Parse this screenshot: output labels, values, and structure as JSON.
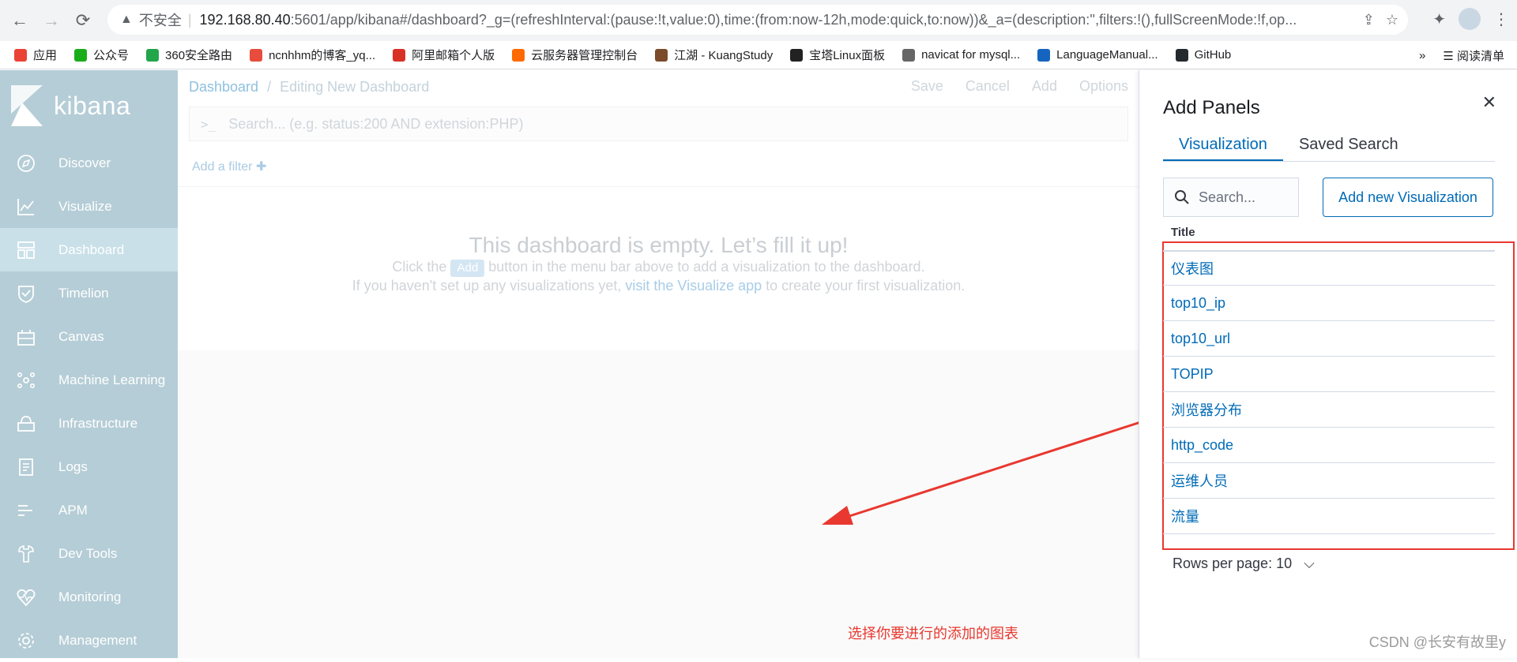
{
  "browser": {
    "security_label": "不安全",
    "url_host": "192.168.80.40",
    "url_rest": ":5601/app/kibana#/dashboard?_g=(refreshInterval:(pause:!t,value:0),time:(from:now-12h,mode:quick,to:now))&_a=(description:'',filters:!(),fullScreenMode:!f,op...",
    "bookmarks": [
      {
        "label": "应用",
        "color": "#ea4335"
      },
      {
        "label": "公众号",
        "color": "#1aad19"
      },
      {
        "label": "360安全路由",
        "color": "#23a54a"
      },
      {
        "label": "ncnhhm的博客_yq...",
        "color": "#e74c3c"
      },
      {
        "label": "阿里邮箱个人版",
        "color": "#d93025"
      },
      {
        "label": "云服务器管理控制台",
        "color": "#ff6a00"
      },
      {
        "label": "江湖 - KuangStudy",
        "color": "#7b4b2a"
      },
      {
        "label": "宝塔Linux面板",
        "color": "#222222"
      },
      {
        "label": "navicat for mysql...",
        "color": "#666666"
      },
      {
        "label": "LanguageManual...",
        "color": "#1565c0"
      },
      {
        "label": "GitHub",
        "color": "#24292e"
      }
    ],
    "more_bookmarks": "»",
    "reading_list": "阅读清单"
  },
  "kibana": {
    "logo_text": "kibana",
    "nav": [
      {
        "label": "Discover",
        "icon": "compass-icon",
        "active": false
      },
      {
        "label": "Visualize",
        "icon": "chart-icon",
        "active": false
      },
      {
        "label": "Dashboard",
        "icon": "dashboard-icon",
        "active": true
      },
      {
        "label": "Timelion",
        "icon": "shield-icon",
        "active": false
      },
      {
        "label": "Canvas",
        "icon": "canvas-icon",
        "active": false
      },
      {
        "label": "Machine Learning",
        "icon": "ml-icon",
        "active": false
      },
      {
        "label": "Infrastructure",
        "icon": "infra-icon",
        "active": false
      },
      {
        "label": "Logs",
        "icon": "logs-icon",
        "active": false
      },
      {
        "label": "APM",
        "icon": "apm-icon",
        "active": false
      },
      {
        "label": "Dev Tools",
        "icon": "wrench-icon",
        "active": false
      },
      {
        "label": "Monitoring",
        "icon": "heartbeat-icon",
        "active": false
      },
      {
        "label": "Management",
        "icon": "gear-icon",
        "active": false
      }
    ],
    "breadcrumb_root": "Dashboard",
    "breadcrumb_sep": "/",
    "breadcrumb_current": "Editing New Dashboard",
    "actions": [
      "Save",
      "Cancel",
      "Add",
      "Options"
    ],
    "query_prompt": ">_",
    "query_placeholder": "Search... (e.g. status:200 AND extension:PHP)",
    "add_filter": "Add a filter",
    "empty_title": "This dashboard is empty. Let’s fill it up!",
    "empty_line1_pre": "Click the",
    "empty_line1_chip": "Add",
    "empty_line1_post": "button in the menu bar above to add a visualization to the dashboard.",
    "empty_line2_pre": "If you haven't set up any visualizations yet,",
    "empty_line2_link": "visit the Visualize app",
    "empty_line2_post": "to create your first visualization."
  },
  "flyout": {
    "title": "Add Panels",
    "tabs": [
      "Visualization",
      "Saved Search"
    ],
    "search_placeholder": "Search...",
    "add_new_label": "Add new Visualization",
    "column_title": "Title",
    "rows": [
      "仪表图",
      "top10_ip",
      "top10_url",
      "TOPIP",
      "浏览器分布",
      "http_code",
      "运维人员",
      "流量"
    ],
    "rows_per_page": "Rows per page: 10"
  },
  "annotation": {
    "text": "选择你要进行的添加的图表",
    "color": "#e8382f"
  },
  "watermark": "CSDN @长安有故里y"
}
